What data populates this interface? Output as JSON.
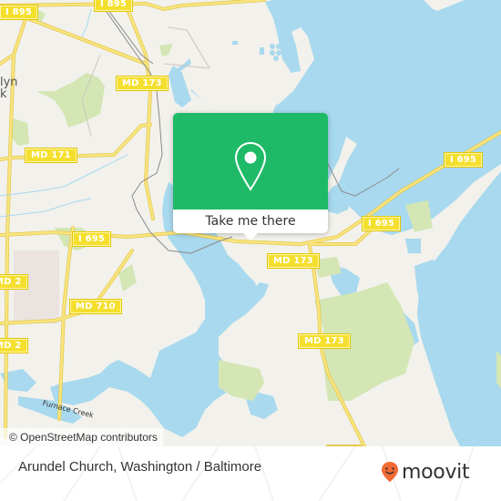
{
  "map": {
    "popup": {
      "icon": "location-pin-icon",
      "action_label": "Take me there",
      "accent_color": "#1fba67"
    },
    "road_shields": [
      {
        "label": "I 895",
        "id": "i895-a"
      },
      {
        "label": "I 895",
        "id": "i895-b"
      },
      {
        "label": "MD 173",
        "id": "md173-a"
      },
      {
        "label": "MD 171",
        "id": "md171"
      },
      {
        "label": "I 695",
        "id": "i695-a"
      },
      {
        "label": "I 695",
        "id": "i695-b"
      },
      {
        "label": "I 695",
        "id": "i695-c"
      },
      {
        "label": "MD 173",
        "id": "md173-b"
      },
      {
        "label": "MD 173",
        "id": "md173-c"
      },
      {
        "label": "MD 2",
        "id": "md2-a"
      },
      {
        "label": "MD 710",
        "id": "md710"
      },
      {
        "label": "MD 2",
        "id": "md2-b"
      }
    ],
    "place_labels": {
      "brooklyn_park_line1": "lyn",
      "brooklyn_park_line2": "k",
      "creek": "Furnace Creek"
    },
    "attribution": "© OpenStreetMap contributors",
    "colors": {
      "land": "#f2f1ec",
      "water": "#a8d9ee",
      "park": "#d3e6b4",
      "highway": "#f6e061",
      "rail": "#7a7a7a"
    }
  },
  "footer": {
    "place_title": "Arundel Church, Washington / Baltimore",
    "brand": {
      "name": "moovit",
      "icon": "moovit-smiley-pin-icon",
      "color": "#f26a34"
    }
  }
}
